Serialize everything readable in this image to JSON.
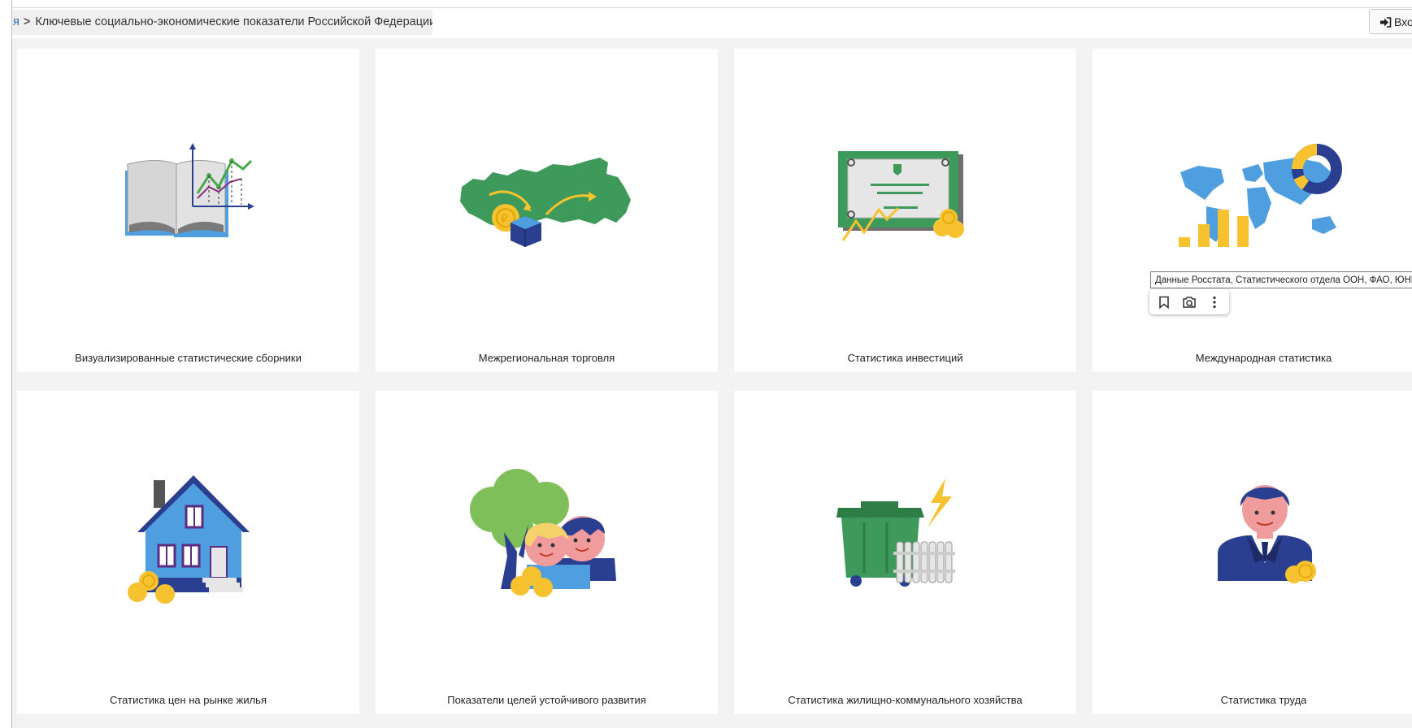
{
  "breadcrumb": {
    "prev": "я",
    "current": "Ключевые социально-экономические показатели Российской Федерации"
  },
  "header": {
    "login_label": "Вход"
  },
  "cards": [
    {
      "title": "Визуализированные статистические сборники",
      "icon": "book-chart-icon"
    },
    {
      "title": "Межрегиональная торговля",
      "icon": "russia-map-trade-icon"
    },
    {
      "title": "Статистика инвестиций",
      "icon": "certificate-investment-icon"
    },
    {
      "title": "Международная статистика",
      "icon": "world-map-chart-icon"
    },
    {
      "title": "Статистика цен на рынке жилья",
      "icon": "house-coins-icon"
    },
    {
      "title": "Показатели целей устойчивого развития",
      "icon": "tree-people-icon"
    },
    {
      "title": "Статистика жилищно-коммунального хозяйства",
      "icon": "dumpster-radiator-icon"
    },
    {
      "title": "Статистика труда",
      "icon": "worker-coins-icon"
    }
  ],
  "tooltip": {
    "text": "Данные Росстата, Статистического отдела ООН, ФАО, ЮНЕСКО"
  },
  "colors": {
    "accent_green": "#3e9a5b",
    "coin_yellow": "#f6c230",
    "navy": "#2a3f8f",
    "sky_blue": "#4f9ee0"
  }
}
